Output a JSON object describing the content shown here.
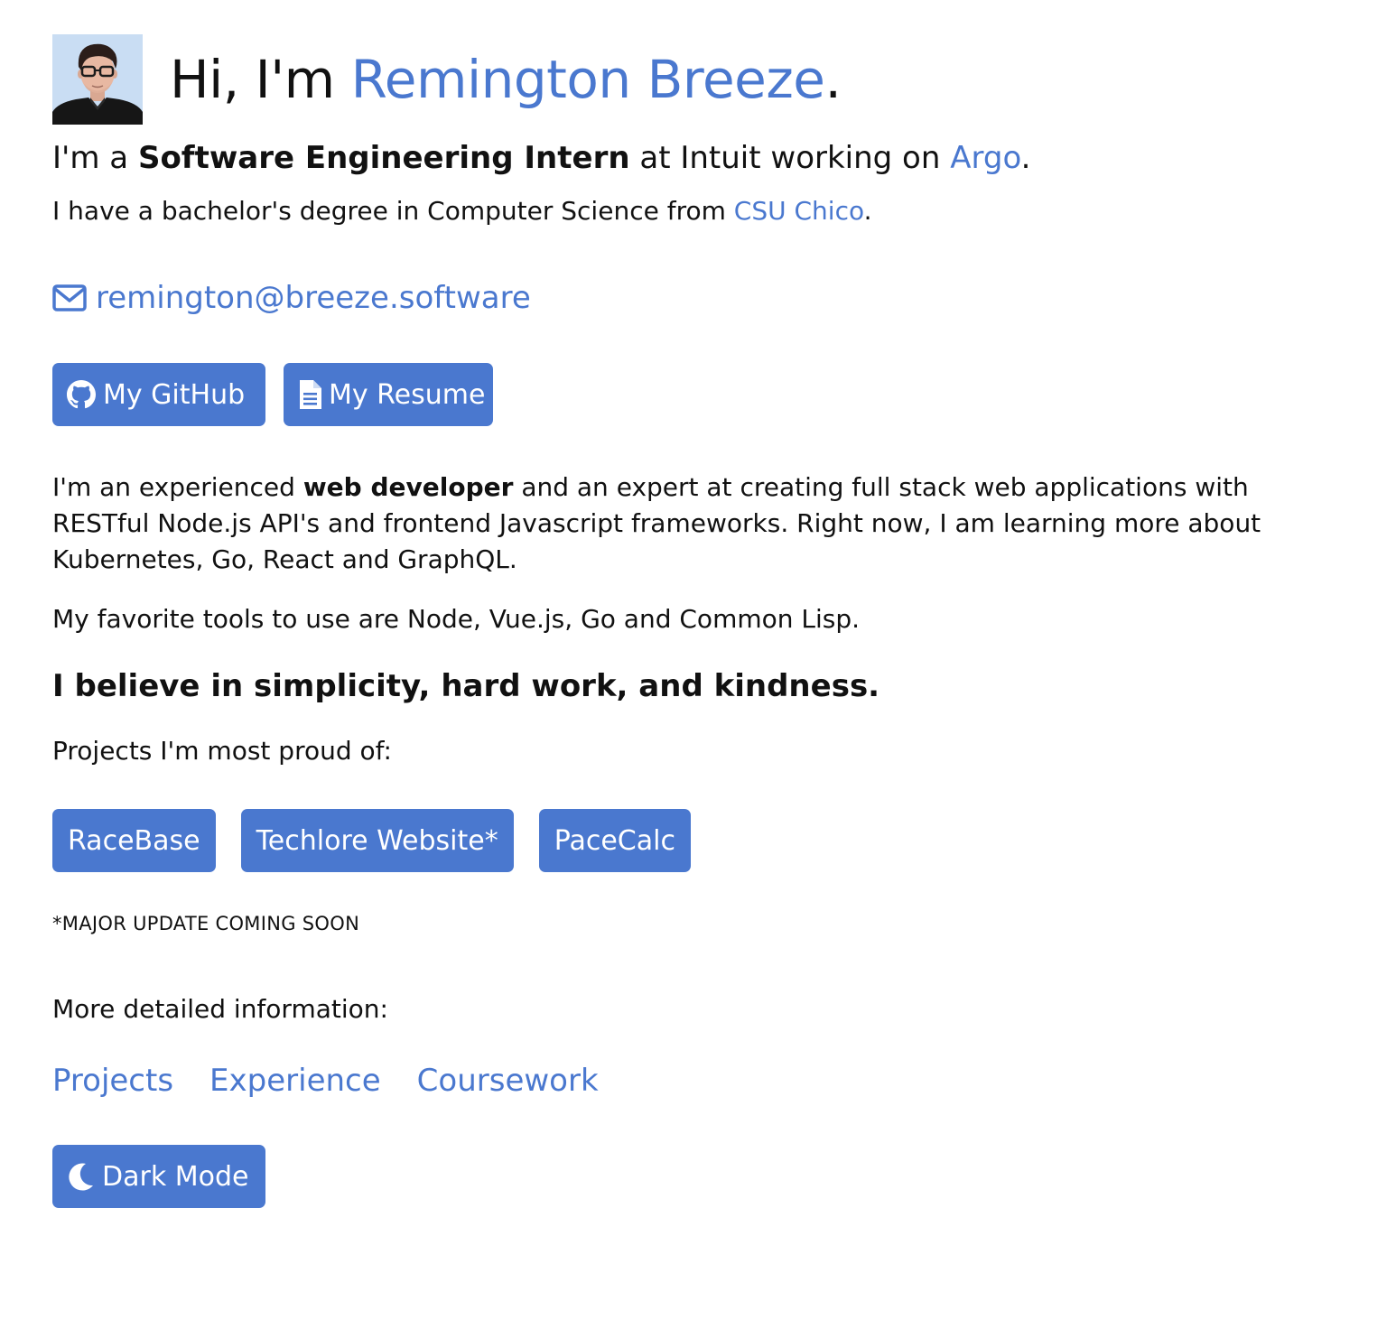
{
  "header": {
    "greeting_prefix": "Hi, I'm ",
    "name": "Remington Breeze",
    "greeting_suffix": "."
  },
  "subtitle": {
    "prefix": "I'm a ",
    "role": "Software Engineering Intern",
    "middle": " at Intuit working on ",
    "project_link": "Argo",
    "suffix": "."
  },
  "degree": {
    "prefix": "I have a bachelor's degree in Computer Science from ",
    "school_link": "CSU Chico",
    "suffix": "."
  },
  "contact": {
    "email": "remington@breeze.software",
    "email_icon": "envelope-icon"
  },
  "buttons": {
    "github_label": "My GitHub",
    "github_icon": "github-icon",
    "resume_label": "My Resume",
    "resume_icon": "file-icon"
  },
  "about": {
    "p1_prefix": "I'm an experienced ",
    "p1_bold": "web developer",
    "p1_rest": " and an expert at creating full stack web applications with RESTful Node.js API's and frontend Javascript frameworks. Right now, I am learning more about Kubernetes, Go, React and GraphQL.",
    "p2": "My favorite tools to use are Node, Vue.js, Go and Common Lisp.",
    "belief": "I believe in simplicity, hard work, and kindness."
  },
  "projects": {
    "intro": "Projects I'm most proud of:",
    "items": [
      {
        "label": "RaceBase"
      },
      {
        "label": "Techlore Website*"
      },
      {
        "label": "PaceCalc"
      }
    ],
    "note": "*MAJOR UPDATE COMING SOON"
  },
  "more": {
    "intro": "More detailed information:",
    "links": [
      {
        "label": "Projects"
      },
      {
        "label": "Experience"
      },
      {
        "label": "Coursework"
      }
    ]
  },
  "theme": {
    "toggle_label": "Dark Mode",
    "toggle_icon": "moon-icon"
  },
  "colors": {
    "accent": "#4a78cf",
    "text": "#111111",
    "background": "#ffffff"
  }
}
